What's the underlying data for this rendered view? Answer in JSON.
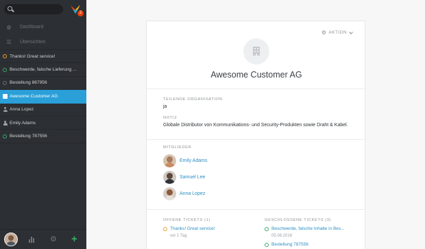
{
  "sidebar": {
    "search": {
      "placeholder": ""
    },
    "logo_badge": "2",
    "nav": [
      {
        "label": "Dashboard",
        "icon": "dashboard-icon"
      },
      {
        "label": "Übersichten",
        "icon": "list-icon"
      }
    ],
    "tasks": [
      {
        "label": "Thanks! Great service!",
        "type": "ticket",
        "status_color": "#f0a429"
      },
      {
        "label": "Beschwerde, falsche Lieferung ...",
        "type": "ticket",
        "status_color": "#38ad69"
      },
      {
        "label": "Bestellung 887956",
        "type": "ticket",
        "status_color": "#6b7076"
      },
      {
        "label": "Awesome Customer AG",
        "type": "organization",
        "active": true
      },
      {
        "label": "Anna Lopez",
        "type": "user"
      },
      {
        "label": "Emily Adams",
        "type": "user"
      },
      {
        "label": "Bestellung 787556",
        "type": "ticket",
        "status_color": "#38ad69"
      }
    ]
  },
  "card": {
    "action_label": "AKTION",
    "org_name": "Awesome Customer AG",
    "shared_label": "TEILENDE ORGANISATION",
    "shared_value": "ja",
    "note_label": "NOTIZ",
    "note_value": "Globale Distributor von Kommunikations- und Security-Produkten sowie Draht & Kabel.",
    "members_label": "MITGLIEDER",
    "members": [
      {
        "name": "Emily Adams"
      },
      {
        "name": "Samuel Lee"
      },
      {
        "name": "Anna Lopez"
      }
    ],
    "open_tickets_label": "OFFENE TICKETS (1)",
    "open_tickets": [
      {
        "title": "Thanks! Great service!",
        "sub": "vor 1 Tag",
        "status_color": "#f0a429"
      }
    ],
    "closed_tickets_label": "GESCHLOSSENE TICKETS (3)",
    "closed_tickets": [
      {
        "title": "Beschwerde, falsche Inhalte in Bes...",
        "sub": "05.08.2016",
        "status_color": "#38ad69"
      },
      {
        "title": "Bestellung 787556",
        "sub": "",
        "status_color": "#38ad69"
      }
    ]
  },
  "colors": {
    "accent": "#2a9fd8",
    "sidebar_bg": "#2c2f33",
    "link": "#2a8fc6"
  }
}
